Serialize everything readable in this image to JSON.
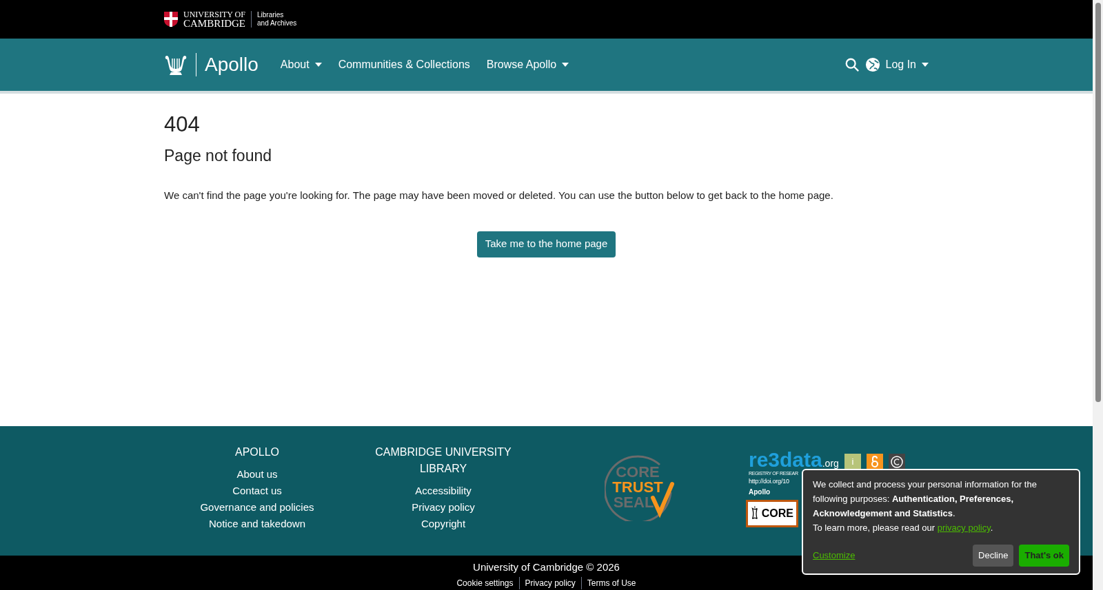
{
  "top_bar": {
    "university_lines": [
      "UNIVERSITY OF",
      "CAMBRIDGE"
    ],
    "department_lines": [
      "Libraries",
      "and Archives"
    ]
  },
  "navbar": {
    "brand": "Apollo",
    "items": [
      {
        "label": "About",
        "dropdown": true
      },
      {
        "label": "Communities & Collections",
        "dropdown": false
      },
      {
        "label": "Browse Apollo",
        "dropdown": true
      }
    ],
    "login": {
      "label": "Log In",
      "dropdown": true
    }
  },
  "content": {
    "code": "404",
    "title": "Page not found",
    "message": "We can't find the page you're looking for. The page may have been moved or deleted. You can use the button below to get back to the home page.",
    "button": "Take me to the home page"
  },
  "footer": {
    "columns": [
      {
        "heading": "APOLLO",
        "links": [
          "About us",
          "Contact us",
          "Governance and policies",
          "Notice and takedown"
        ]
      },
      {
        "heading": "CAMBRIDGE UNIVERSITY LIBRARY",
        "links": [
          "Accessibility",
          "Privacy policy",
          "Copyright"
        ]
      }
    ],
    "seal_lines": [
      "CORE",
      "TRUST",
      "SEAL"
    ],
    "re3data": {
      "logo": "re3data",
      "logo_suffix": ".org",
      "info": "i",
      "registry": "REGISTRY OF RESEAR",
      "doi": "http://doi.org/10",
      "name": "Apollo",
      "core": "CORE"
    }
  },
  "bottom_bar": {
    "copyright": "University of Cambridge © 2026",
    "links": [
      "Cookie settings",
      "Privacy policy",
      "Terms of Use"
    ]
  },
  "cookie_notice": {
    "text": "We collect and process your personal information for the following purposes: **Authentication, Preferences, Acknowledgement and Statistics**.",
    "more": "To learn more, please read our",
    "link": "privacy policy",
    "end": ".",
    "customize": "Customize",
    "decline": "Decline",
    "accept": "That's ok"
  }
}
